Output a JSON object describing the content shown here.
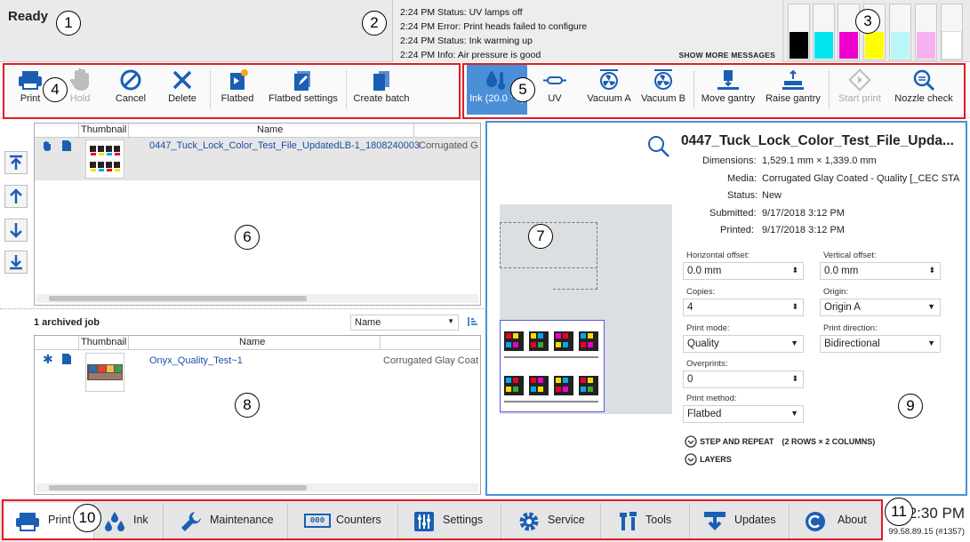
{
  "status": {
    "ready_label": "Ready",
    "messages": [
      "2:24 PM Status: UV lamps off",
      "2:24 PM Error: Print heads failed to configure",
      "2:24 PM Status: Ink warming up",
      "2:24 PM Info: Air pressure is good"
    ],
    "show_more": "SHOW MORE MESSAGES",
    "ink_colors": [
      "#000000",
      "#00e5ee",
      "#ef00ce",
      "#ffff00",
      "#b8f7f7",
      "#f7b0f0",
      "#ffffff"
    ]
  },
  "toolbar": {
    "print": "Print",
    "hold": "Hold",
    "cancel": "Cancel",
    "delete": "Delete",
    "flatbed": "Flatbed",
    "flatbed_settings": "Flatbed settings",
    "create_batch": "Create batch",
    "ink": "Ink (20.0 °C)",
    "uv": "UV",
    "vacuum_a": "Vacuum A",
    "vacuum_b": "Vacuum B",
    "move_gantry": "Move gantry",
    "raise_gantry": "Raise gantry",
    "start_print": "Start print",
    "nozzle_check": "Nozzle check"
  },
  "queue": {
    "headers": {
      "thumbnail": "Thumbnail",
      "name": "Name"
    },
    "rows": [
      {
        "name": "0447_Tuck_Lock_Color_Test_File_UpdatedLB-1_1808240003",
        "media": "Corrugated G"
      }
    ]
  },
  "archive": {
    "count_label": "1 archived job",
    "sort_value": "Name",
    "headers": {
      "thumbnail": "Thumbnail",
      "name": "Name"
    },
    "rows": [
      {
        "name": "Onyx_Quality_Test~1",
        "media": "Corrugated Glay Coat"
      }
    ]
  },
  "detail": {
    "title": "0447_Tuck_Lock_Color_Test_File_Upda...",
    "dimensions_label": "Dimensions:",
    "dimensions": "1,529.1 mm × 1,339.0 mm",
    "media_label": "Media:",
    "media": "Corrugated Glay Coated - Quality [_CEC STA",
    "status_label": "Status:",
    "status": "New",
    "submitted_label": "Submitted:",
    "submitted": "9/17/2018 3:12 PM",
    "printed_label": "Printed:",
    "printed": "9/17/2018 3:12 PM",
    "h_offset_label": "Horizontal offset:",
    "h_offset": "0.0 mm",
    "v_offset_label": "Vertical offset:",
    "v_offset": "0.0 mm",
    "copies_label": "Copies:",
    "copies": "4",
    "origin_label": "Origin:",
    "origin": "Origin A",
    "print_mode_label": "Print mode:",
    "print_mode": "Quality",
    "print_direction_label": "Print direction:",
    "print_direction": "Bidirectional",
    "overprints_label": "Overprints:",
    "overprints": "0",
    "print_method_label": "Print method:",
    "print_method": "Flatbed",
    "step_repeat": "STEP AND REPEAT",
    "step_repeat_value": "(2 ROWS × 2 COLUMNS)",
    "layers": "LAYERS"
  },
  "nav": {
    "print": "Print",
    "ink": "Ink",
    "maintenance": "Maintenance",
    "counters": "Counters",
    "settings": "Settings",
    "service": "Service",
    "tools": "Tools",
    "updates": "Updates",
    "about": "About"
  },
  "clock": {
    "time": "2:30 PM",
    "version": "99.58.89.15 (#1357)"
  },
  "callouts": [
    "1",
    "2",
    "3",
    "4",
    "5",
    "6",
    "7",
    "8",
    "9",
    "10",
    "11"
  ],
  "colors": {
    "accent": "#4b8fd9",
    "frame": "#e31b23",
    "link": "#1a4fa8"
  }
}
